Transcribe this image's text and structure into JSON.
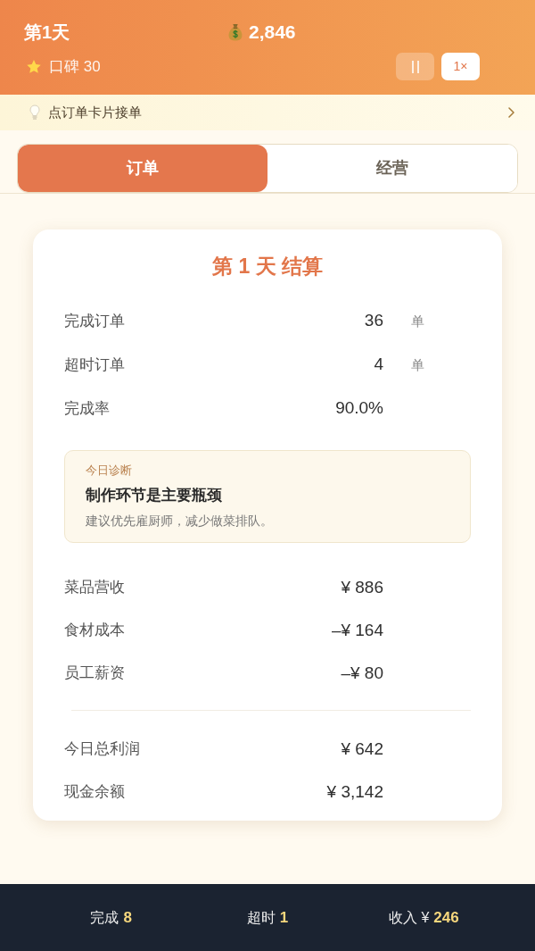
{
  "header": {
    "day": "第1天",
    "money": "2,846",
    "reputation": "口碑 30",
    "controls": [
      {
        "kind": "pause",
        "selected": false
      },
      {
        "kind": "speed",
        "label": "1×",
        "selected": true
      }
    ]
  },
  "hint_bar": {
    "text": "点订单卡片接单"
  },
  "tabs": [
    {
      "label": "订单",
      "selected": true
    },
    {
      "label": "经营",
      "selected": false
    }
  ],
  "summary_card": {
    "title": "第 1 天 结算",
    "order_stats": [
      {
        "label": "完成订单",
        "value": "36",
        "unit": "单"
      },
      {
        "label": "超时订单",
        "value": "4",
        "unit": "单"
      },
      {
        "label": "完成率",
        "value": "90.0%"
      }
    ],
    "diagnosis": {
      "label": "今日诊断",
      "title": "制作环节是主要瓶颈",
      "description": "建议优先雇厨师，减少做菜排队。"
    },
    "finances": [
      {
        "label": "菜品营收",
        "value": "¥ 886"
      },
      {
        "label": "食材成本",
        "value": "–¥ 164"
      },
      {
        "label": "员工薪资",
        "value": "–¥ 80"
      }
    ],
    "totals": [
      {
        "label": "今日总利润",
        "value": "¥ 642"
      },
      {
        "label": "现金余额",
        "value": "¥ 3,142"
      }
    ]
  },
  "status_bar": [
    {
      "label": "完成",
      "value": "8"
    },
    {
      "label": "超时",
      "value": "1"
    },
    {
      "label": "收入 ¥",
      "value": "246"
    }
  ]
}
